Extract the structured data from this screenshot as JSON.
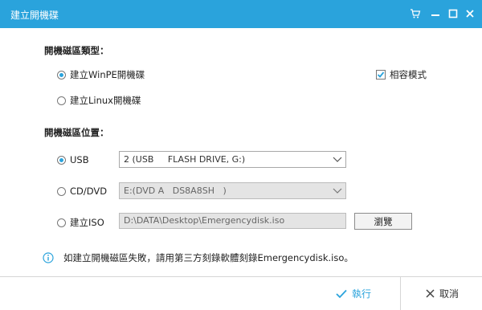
{
  "window": {
    "title": "建立開機碟",
    "icons": [
      "cart-icon",
      "minimize-icon",
      "maximize-icon",
      "close-icon"
    ]
  },
  "boot_type": {
    "label": "開機磁區類型：",
    "options": [
      {
        "label": "建立WinPE開機碟",
        "checked": true
      },
      {
        "label": "建立Linux開機碟",
        "checked": false
      }
    ],
    "compat_mode": {
      "label": "相容模式",
      "checked": true
    }
  },
  "boot_location": {
    "label": "開機磁區位置：",
    "usb": {
      "label": "USB",
      "checked": true,
      "value": "2 (USB     FLASH DRIVE, G:)"
    },
    "cddvd": {
      "label": "CD/DVD",
      "checked": false,
      "value": "E:(DVD A   DS8A8SH   )"
    },
    "iso": {
      "label": "建立ISO",
      "checked": false,
      "path": "D:\\DATA\\Desktop\\Emergencydisk.iso",
      "browse_label": "瀏覽"
    }
  },
  "info": {
    "text": "如建立開機磁區失敗，請用第三方刻錄軟體刻錄Emergencydisk.iso。"
  },
  "footer": {
    "execute_label": "執行",
    "cancel_label": "取消"
  },
  "colors": {
    "accent": "#2aa3dc",
    "titlebar": "#2aa3dc"
  }
}
